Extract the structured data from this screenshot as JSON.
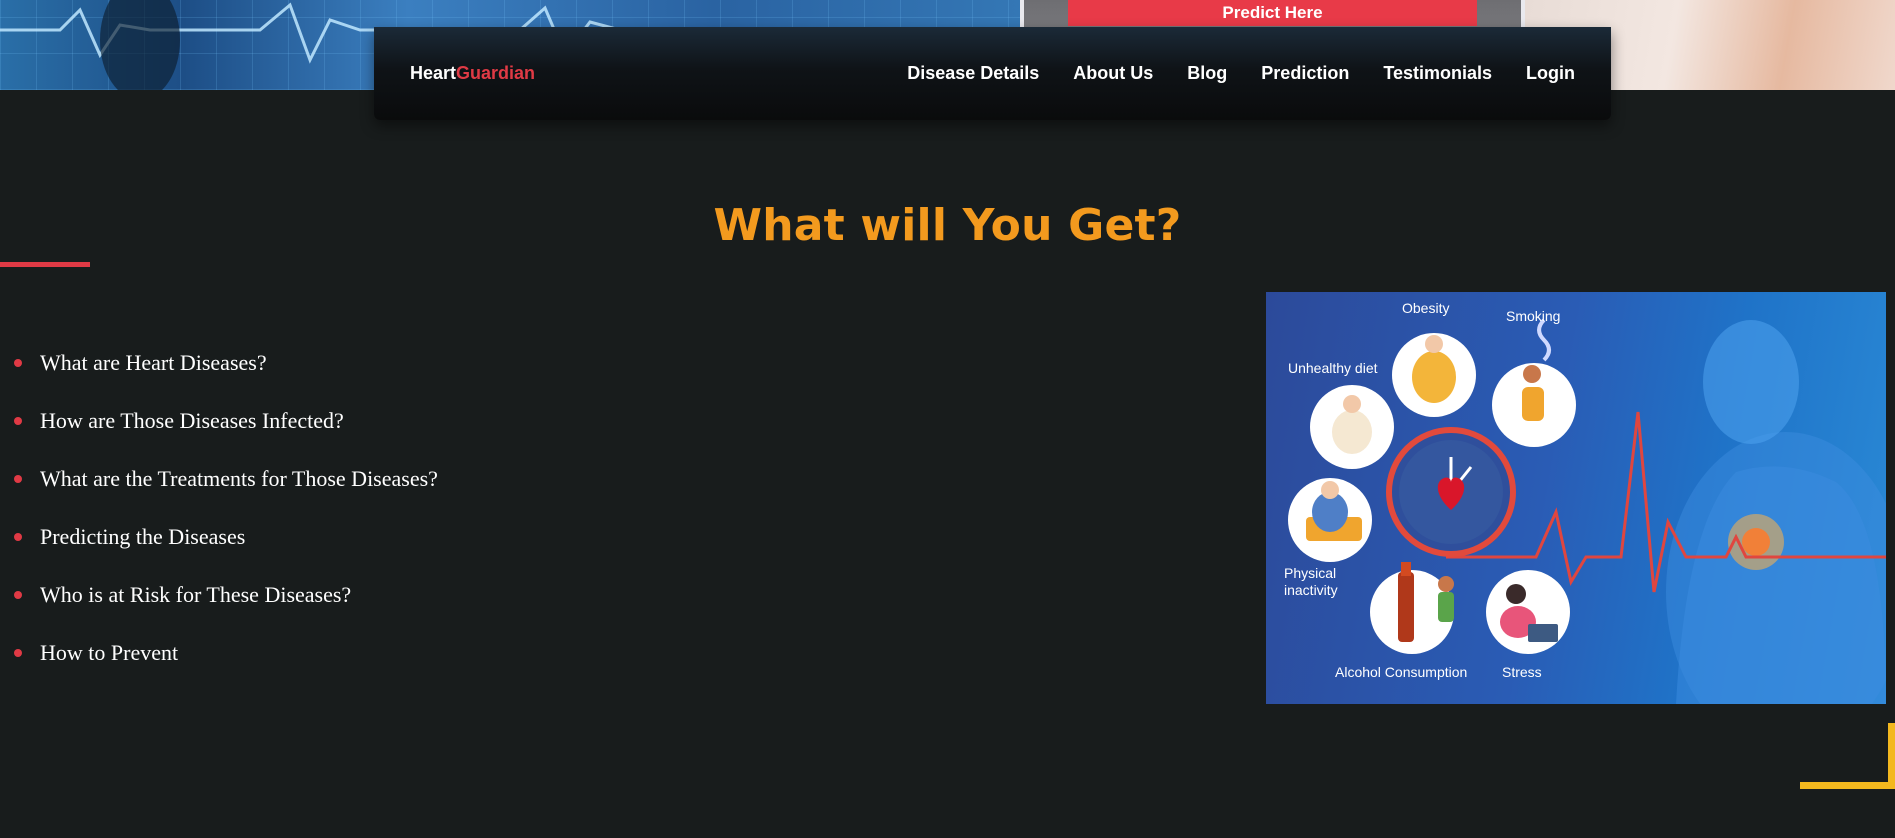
{
  "hero": {
    "predict_button": "Predict Here"
  },
  "navbar": {
    "brand_part1": "Heart",
    "brand_part2": "Guardian",
    "links": [
      "Disease Details",
      "About Us",
      "Blog",
      "Prediction",
      "Testimonials",
      "Login"
    ]
  },
  "section": {
    "title": "What will You Get?",
    "items": [
      "What are Heart Diseases?",
      "How are Those Diseases Infected?",
      "What are the Treatments for Those Diseases?",
      "Predicting the Diseases",
      "Who is at Risk for These Diseases?",
      "How to Prevent"
    ]
  },
  "infographic": {
    "labels": {
      "obesity": "Obesity",
      "smoking": "Smoking",
      "unhealthy_diet": "Unhealthy diet",
      "physical_inactivity_line1": "Physical",
      "physical_inactivity_line2": "inactivity",
      "alcohol": "Alcohol Consumption",
      "stress": "Stress"
    }
  },
  "colors": {
    "background": "#181c1c",
    "title": "#f39a1e",
    "accent_red": "#e03a45",
    "accent_yellow": "#f3b81e"
  }
}
